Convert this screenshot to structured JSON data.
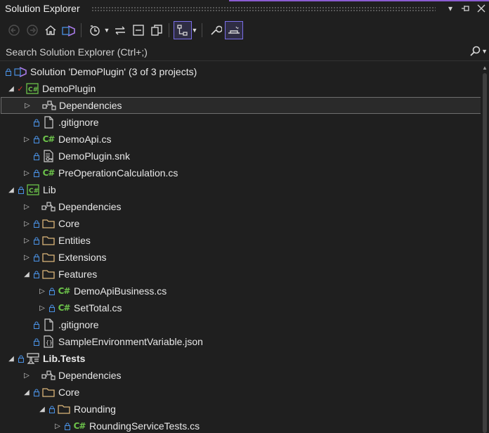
{
  "window": {
    "title": "Solution Explorer",
    "controls": [
      "dropdown",
      "pin",
      "close"
    ]
  },
  "search": {
    "placeholder": "Search Solution Explorer (Ctrl+;)"
  },
  "tree": [
    {
      "name": "solution-node",
      "label": "Solution 'DemoPlugin' (3 of 3 projects)",
      "icon": "solution-icon",
      "indent": 0,
      "expander": "none",
      "lock": true
    },
    {
      "name": "project-demoplugin",
      "label": "DemoPlugin",
      "icon": "csharp-project-icon",
      "indent": 1,
      "expander": "expanded",
      "lock": false,
      "check": true
    },
    {
      "name": "dependencies-node",
      "label": "Dependencies",
      "icon": "dependencies-icon",
      "indent": 2,
      "expander": "collapsed",
      "lock": false,
      "selected": true
    },
    {
      "name": "file-gitignore",
      "label": ".gitignore",
      "icon": "file-icon",
      "indent": 2,
      "expander": "none",
      "lock": true
    },
    {
      "name": "file-demoapi",
      "label": "DemoApi.cs",
      "icon": "csharp-file-icon",
      "indent": 2,
      "expander": "collapsed",
      "lock": true
    },
    {
      "name": "file-demoplugin-snk",
      "label": "DemoPlugin.snk",
      "icon": "key-file-icon",
      "indent": 2,
      "expander": "none",
      "lock": true
    },
    {
      "name": "file-preoperation",
      "label": "PreOperationCalculation.cs",
      "icon": "csharp-file-icon",
      "indent": 2,
      "expander": "collapsed",
      "lock": true
    },
    {
      "name": "project-lib",
      "label": "Lib",
      "icon": "csharp-project-icon",
      "indent": 1,
      "expander": "expanded",
      "lock": true
    },
    {
      "name": "dependencies-node",
      "label": "Dependencies",
      "icon": "dependencies-icon",
      "indent": 2,
      "expander": "collapsed",
      "lock": false
    },
    {
      "name": "folder-core",
      "label": "Core",
      "icon": "folder-icon",
      "indent": 2,
      "expander": "collapsed",
      "lock": true
    },
    {
      "name": "folder-entities",
      "label": "Entities",
      "icon": "folder-icon",
      "indent": 2,
      "expander": "collapsed",
      "lock": true
    },
    {
      "name": "folder-extensions",
      "label": "Extensions",
      "icon": "folder-icon",
      "indent": 2,
      "expander": "collapsed",
      "lock": true
    },
    {
      "name": "folder-features",
      "label": "Features",
      "icon": "folder-icon",
      "indent": 2,
      "expander": "expanded",
      "lock": true
    },
    {
      "name": "file-demoapibusiness",
      "label": "DemoApiBusiness.cs",
      "icon": "csharp-file-icon",
      "indent": 3,
      "expander": "collapsed",
      "lock": true
    },
    {
      "name": "file-settotal",
      "label": "SetTotal.cs",
      "icon": "csharp-file-icon",
      "indent": 3,
      "expander": "collapsed",
      "lock": true
    },
    {
      "name": "file-gitignore",
      "label": ".gitignore",
      "icon": "file-icon",
      "indent": 2,
      "expander": "none",
      "lock": true
    },
    {
      "name": "file-sampleenv",
      "label": "SampleEnvironmentVariable.json",
      "icon": "json-file-icon",
      "indent": 2,
      "expander": "none",
      "lock": true
    },
    {
      "name": "project-lib-tests",
      "label": "Lib.Tests",
      "icon": "test-project-icon",
      "indent": 1,
      "expander": "expanded",
      "lock": true,
      "bold": true
    },
    {
      "name": "dependencies-node",
      "label": "Dependencies",
      "icon": "dependencies-icon",
      "indent": 2,
      "expander": "collapsed",
      "lock": false
    },
    {
      "name": "folder-core",
      "label": "Core",
      "icon": "folder-icon",
      "indent": 2,
      "expander": "expanded",
      "lock": true
    },
    {
      "name": "folder-rounding",
      "label": "Rounding",
      "icon": "folder-icon",
      "indent": 3,
      "expander": "expanded",
      "lock": true
    },
    {
      "name": "file-roundingservicetests",
      "label": "RoundingServiceTests.cs",
      "icon": "csharp-file-icon",
      "indent": 4,
      "expander": "collapsed",
      "lock": true
    }
  ],
  "colors": {
    "background": "#1f1f1f",
    "accent": "#8a5cd1",
    "csharp": "#6cc24a",
    "lock": "#4a90e2",
    "folder": "#dcb67a",
    "check": "#c9372c"
  }
}
